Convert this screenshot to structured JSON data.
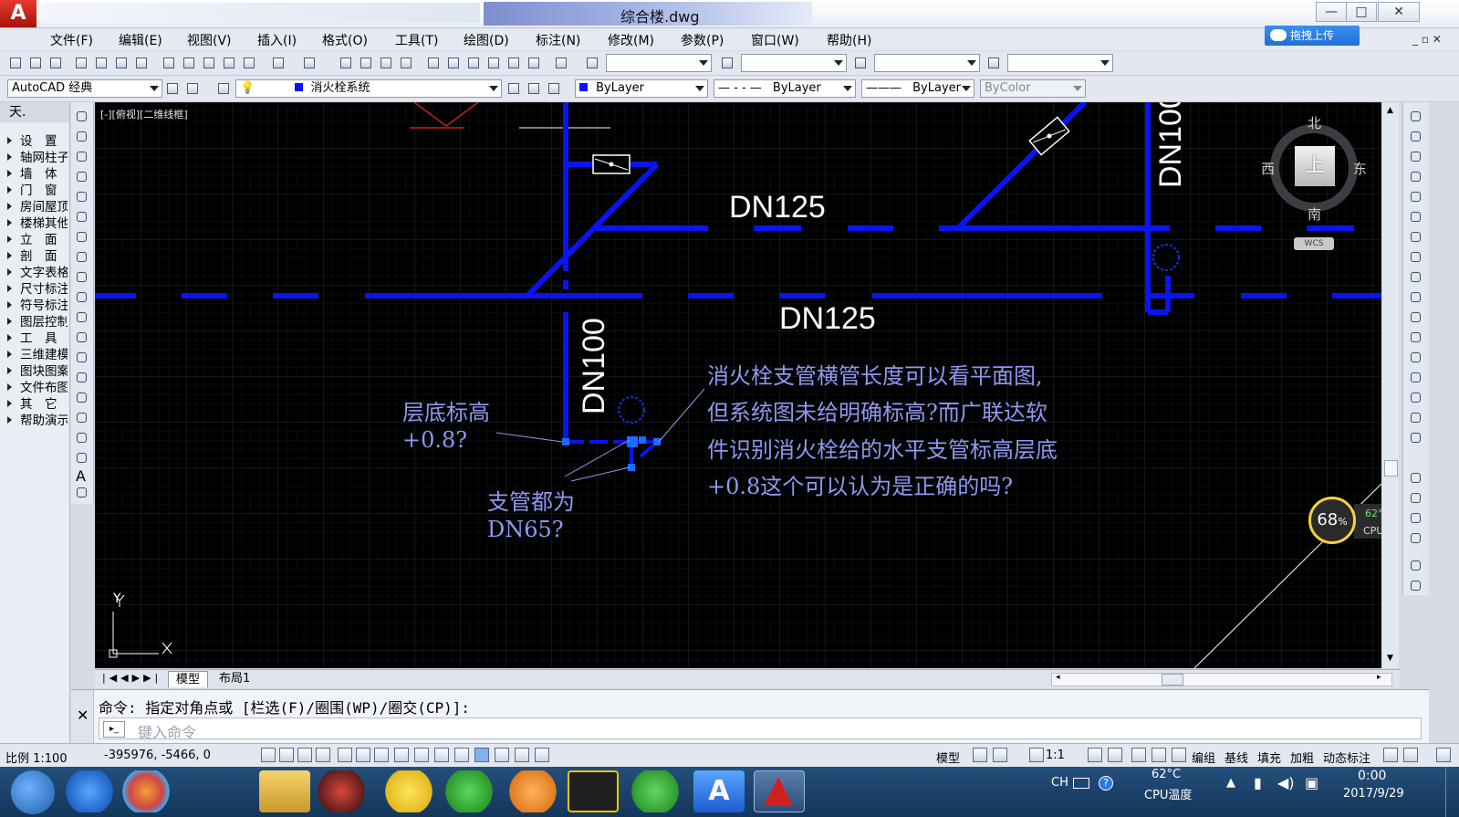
{
  "app": {
    "logo_letter": "A",
    "document_title": "综合楼.dwg"
  },
  "window_buttons": {
    "minimize": "—",
    "maximize": "□",
    "close": "✕"
  },
  "menu": {
    "items": [
      "文件(F)",
      "编辑(E)",
      "视图(V)",
      "插入(I)",
      "格式(O)",
      "工具(T)",
      "绘图(D)",
      "标注(N)",
      "修改(M)",
      "参数(P)",
      "窗口(W)",
      "帮助(H)"
    ]
  },
  "upload_button": {
    "label": "拖拽上传"
  },
  "toolbar2": {
    "workspace": "AutoCAD 经典",
    "layer": "消火栓系统",
    "color": "ByLayer",
    "linetype": "ByLayer",
    "lineweight": "ByLayer",
    "plotstyle": "ByColor"
  },
  "palette": {
    "header": "天.",
    "items": [
      "设　置",
      "轴网柱子",
      "墙　体",
      "门　窗",
      "房间屋顶",
      "楼梯其他",
      "立　面",
      "剖　面",
      "文字表格",
      "尺寸标注",
      "符号标注",
      "图层控制",
      "工　具",
      "三维建模",
      "图块图案",
      "文件布图",
      "其　它",
      "帮助演示"
    ]
  },
  "viewport": {
    "label": "[-][俯视][二维线框]"
  },
  "drawing": {
    "dims": [
      "DN125",
      "DN125",
      "DN100",
      "DN100"
    ],
    "notes": {
      "floor_elev_line1": "层底标高",
      "floor_elev_line2": "+0.8?",
      "branch_line1": "支管都为",
      "branch_line2": "DN65?",
      "question_lines": [
        "消火栓支管横管长度可以看平面图,",
        "但系统图未给明确标高?而广联达软",
        "件识别消火栓给的水平支管标高层底",
        "+0.8这个可以认为是正确的吗?"
      ]
    },
    "ucs": {
      "x": "X",
      "y": "Y"
    }
  },
  "viewcube": {
    "north": "北",
    "south": "南",
    "east": "东",
    "west": "西",
    "top": "上",
    "wcs": "WCS"
  },
  "cpu_widget": {
    "usage": "68",
    "unit": "%",
    "temp": "62℃",
    "label": "CPU温度"
  },
  "tabs": {
    "model": "模型",
    "layout1": "布局1"
  },
  "command": {
    "history": "命令: 指定对角点或 [栏选(F)/圈围(WP)/圈交(CP)]:",
    "placeholder": "键入命令"
  },
  "status": {
    "scale": "比例 1:100",
    "coords": "-395976, -5466, 0",
    "model": "模型",
    "annoscale": "1:1",
    "buttons": [
      "编组",
      "基线",
      "填充",
      "加粗",
      "动态标注"
    ]
  },
  "taskbar": {
    "lang": "CH",
    "temp": "62°C",
    "temp_label": "CPU温度",
    "time": "0:00",
    "date": "2017/9/29"
  },
  "colors": {
    "pipe": "#0a14f0",
    "canvas": "#000000",
    "note": "#8f98f0",
    "accent": "#f2d43a"
  }
}
